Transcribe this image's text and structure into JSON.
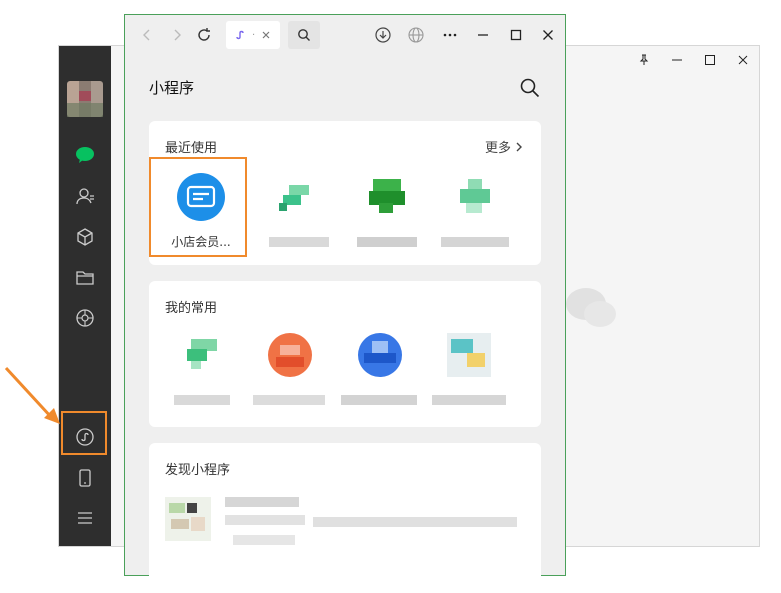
{
  "background_window": {
    "controls": [
      "pin",
      "minimize",
      "maximize",
      "close"
    ]
  },
  "sidebar": {
    "icons": [
      "chat-icon",
      "contacts-icon",
      "favorites-icon",
      "files-icon",
      "moments-icon",
      "mini-program-icon",
      "phone-icon",
      "menu-icon"
    ]
  },
  "mini_program_window": {
    "title": "小程序",
    "tab_glyph": "·",
    "recent": {
      "title": "最近使用",
      "more_label": "更多",
      "apps": [
        {
          "label": "小店会员..."
        }
      ]
    },
    "frequent": {
      "title": "我的常用"
    },
    "discover": {
      "title": "发现小程序"
    }
  },
  "colors": {
    "highlight": "#f08a2c",
    "wechat_green": "#07c160",
    "window_border": "#4aa05a",
    "app_blue": "#1d8fe8"
  }
}
